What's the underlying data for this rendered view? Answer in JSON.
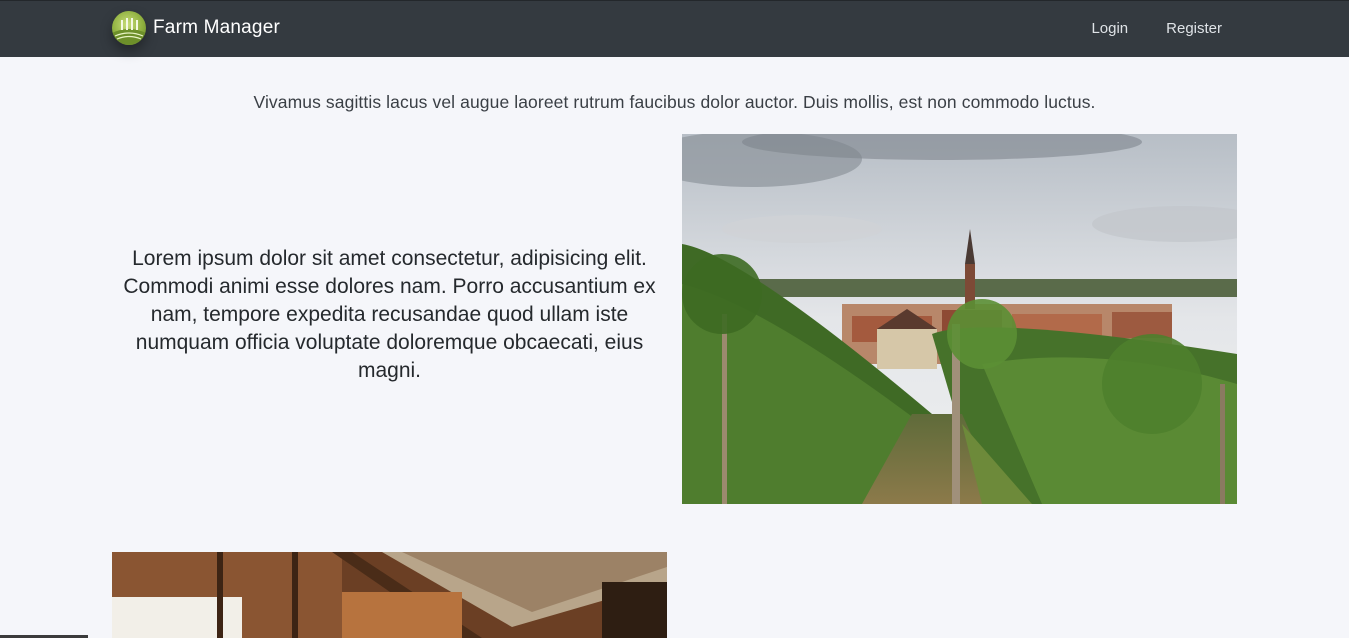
{
  "navbar": {
    "brand_name": "Farm Manager",
    "logo_icon": "farm-field-logo",
    "links": [
      {
        "label": "Login"
      },
      {
        "label": "Register"
      }
    ],
    "background_color": "#343a40"
  },
  "tagline": "Vivamus sagittis lacus vel augue laoreet rutrum faucibus dolor auctor. Duis mollis, est non commodo luctus.",
  "intro_text": "Lorem ipsum dolor sit amet consectetur, adipisicing elit. Commodi animi esse dolores nam. Porro accusantium ex nam, tempore expedita recusandae quod ullam iste numquam officia voluptate doloremque obcaecati, eius magni.",
  "images": [
    {
      "name": "vineyard-village-photo"
    },
    {
      "name": "barn-interior-photo"
    }
  ]
}
